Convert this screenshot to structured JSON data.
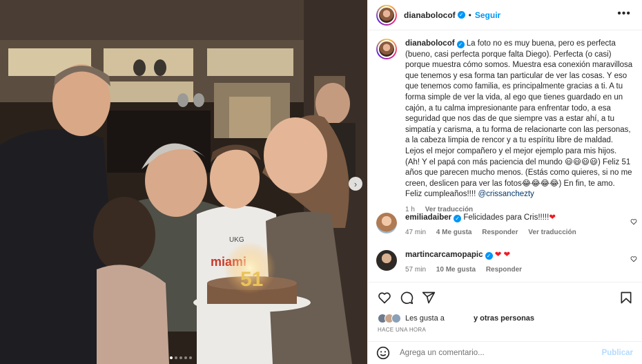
{
  "post": {
    "username": "dianabolocof",
    "follow_label": "Seguir",
    "separator": "•",
    "more_label": "•••",
    "caption_text": "La foto no es muy buena, pero es perfecta (bueno, casi perfecta porque falta Diego). Perfecta (o casi) porque muestra cómo somos. Muestra esa conexión maravillosa que tenemos y esa forma tan particular de ver las cosas. Y eso que tenemos como familia, es principalmente gracias a ti. A tu forma simple de ver la vida, al ego que tienes guardado en un cajón, a tu calma impresionante para enfrentar todo, a esa seguridad que nos das de que siempre vas a estar ahí, a tu simpatía y carisma, a tu forma de relacionarte con las personas, a la cabeza limpia de rencor y a tu espíritu libre de maldad. Lejos el mejor compañero y el mejor ejemplo para mis hijos. (Ah! Y el papá con más paciencia del mundo 😃😃😃😃) Feliz 51 años que parecen mucho menos. (Estás como quieres, si no me creen, deslicen para ver las fotos😂😂😂😂) En fin, te amo. Feliz cumpleaños!!!! ",
    "caption_mention": "@crissanchezty",
    "caption_time": "1 h",
    "see_translation": "Ver traducción",
    "photo_cake_number": "51",
    "next_label": "›"
  },
  "comments": [
    {
      "username": "emiliadaiber",
      "text": "Felicidades para Cris!!!!!",
      "emoji": "❤",
      "time": "47 min",
      "likes": "4 Me gusta",
      "reply": "Responder",
      "translate": "Ver traducción"
    },
    {
      "username": "martincarcamopapic",
      "text": "",
      "emoji": "❤ ❤",
      "time": "57 min",
      "likes": "10 Me gusta",
      "reply": "Responder"
    }
  ],
  "likes_text_prefix": "Les gusta a",
  "likes_text_suffix": "y otras personas",
  "posted_ago": "HACE UNA HORA",
  "add_comment_placeholder": "Agrega un comentario...",
  "publish_label": "Publicar",
  "colors": {
    "accent": "#0095f6",
    "heart": "#ed1c24",
    "muted": "#737373"
  }
}
